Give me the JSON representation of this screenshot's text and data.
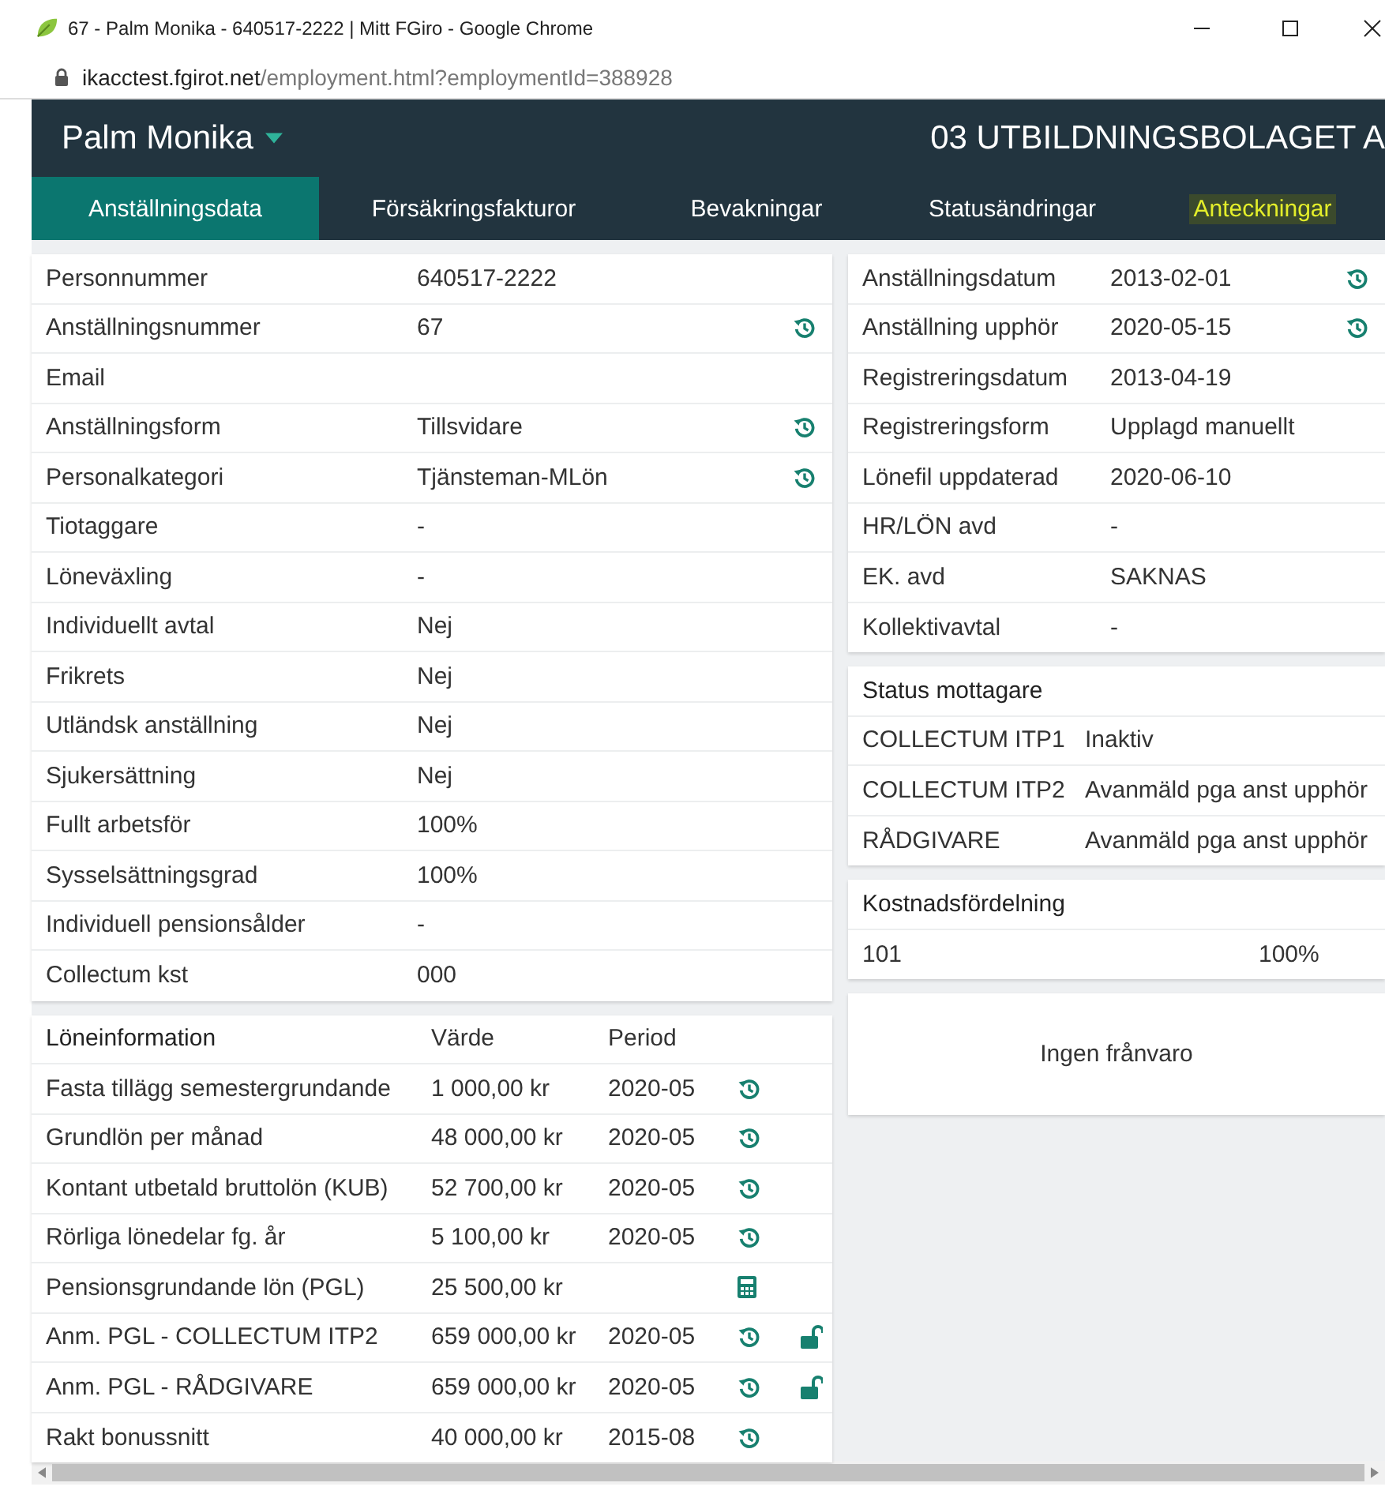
{
  "browser": {
    "title": "67 - Palm Monika - 640517-2222 | Mitt FGiro - Google Chrome",
    "url_host": "ikacctest.fgirot.net",
    "url_path": "/employment.html?employmentId=388928"
  },
  "header": {
    "person": "Palm Monika",
    "company": "03 UTBILDNINGSBOLAGET A"
  },
  "tabs": [
    {
      "label": "Anställningsdata",
      "selected": true,
      "highlighted": false
    },
    {
      "label": "Försäkringsfakturor",
      "selected": false,
      "highlighted": false
    },
    {
      "label": "Bevakningar",
      "selected": false,
      "highlighted": false
    },
    {
      "label": "Statusändringar",
      "selected": false,
      "highlighted": false
    },
    {
      "label": "Anteckningar",
      "selected": false,
      "highlighted": true
    }
  ],
  "employee_details": [
    {
      "label": "Personnummer",
      "value": "640517-2222"
    },
    {
      "label": "Anställningsnummer",
      "value": "67",
      "history": true
    },
    {
      "label": "Email"
    },
    {
      "label": "Anställningsform",
      "value": "Tillsvidare",
      "history": true
    },
    {
      "label": "Personalkategori",
      "value": "Tjänsteman-MLön",
      "history": true
    },
    {
      "label": "Tiotaggare",
      "value": "-"
    },
    {
      "label": "Löneväxling",
      "value": "-"
    },
    {
      "label": "Individuellt avtal",
      "value": "Nej"
    },
    {
      "label": "Frikrets",
      "value": "Nej"
    },
    {
      "label": "Utländsk anställning",
      "value": "Nej"
    },
    {
      "label": "Sjukersättning",
      "value": "Nej"
    },
    {
      "label": "Fullt arbetsför",
      "value": "100%"
    },
    {
      "label": "Sysselsättningsgrad",
      "value": "100%"
    },
    {
      "label": "Individuell pensionsålder",
      "value": "-"
    },
    {
      "label": "Collectum kst",
      "value": "000"
    }
  ],
  "employment_dates": [
    {
      "label": "Anställningsdatum",
      "value": "2013-02-01",
      "history": true
    },
    {
      "label": "Anställning upphör",
      "value": "2020-05-15",
      "history": true
    },
    {
      "label": "Registreringsdatum",
      "value": "2013-04-19"
    },
    {
      "label": "Registreringsform",
      "value": "Upplagd manuellt"
    },
    {
      "label": "Lönefil uppdaterad",
      "value": "2020-06-10"
    },
    {
      "label": "HR/LÖN avd",
      "value": "-"
    },
    {
      "label": "EK. avd",
      "value": "SAKNAS"
    },
    {
      "label": "Kollektivavtal",
      "value": "-"
    }
  ],
  "status_recipients": {
    "title": "Status mottagare",
    "rows": [
      {
        "recipient": "COLLECTUM ITP1",
        "status": "Inaktiv"
      },
      {
        "recipient": "COLLECTUM ITP2",
        "status": "Avanmäld pga anst upphör"
      },
      {
        "recipient": "RÅDGIVARE",
        "status": "Avanmäld pga anst upphör"
      }
    ]
  },
  "cost_distribution": {
    "title": "Kostnadsfördelning",
    "rows": [
      {
        "column_1": "101",
        "column_2": "100%"
      }
    ]
  },
  "absence": {
    "message": "Ingen frånvaro"
  },
  "salary": {
    "columns": [
      "Löneinformation",
      "Värde",
      "Period"
    ],
    "rows": [
      {
        "label": "Fasta tillägg semestergrundande",
        "value": "1 000,00 kr",
        "period": "2020-05",
        "history": true
      },
      {
        "label": "Grundlön per månad",
        "value": "48 000,00 kr",
        "period": "2020-05",
        "history": true
      },
      {
        "label": "Kontant utbetald bruttolön (KUB)",
        "value": "52 700,00 kr",
        "period": "2020-05",
        "history": true
      },
      {
        "label": "Rörliga lönedelar fg. år",
        "value": "5 100,00 kr",
        "period": "2020-05",
        "history": true
      },
      {
        "label": "Pensionsgrundande lön (PGL)",
        "value": "25 500,00 kr",
        "calculator": true
      },
      {
        "label": "Anm. PGL - COLLECTUM ITP2",
        "value": "659 000,00 kr",
        "period": "2020-05",
        "history": true,
        "unlocked": true
      },
      {
        "label": "Anm. PGL - RÅDGIVARE",
        "value": "659 000,00 kr",
        "period": "2020-05",
        "history": true,
        "unlocked": true
      },
      {
        "label": "Rakt bonussnitt",
        "value": "40 000,00 kr",
        "period": "2015-08",
        "history": true
      }
    ]
  }
}
